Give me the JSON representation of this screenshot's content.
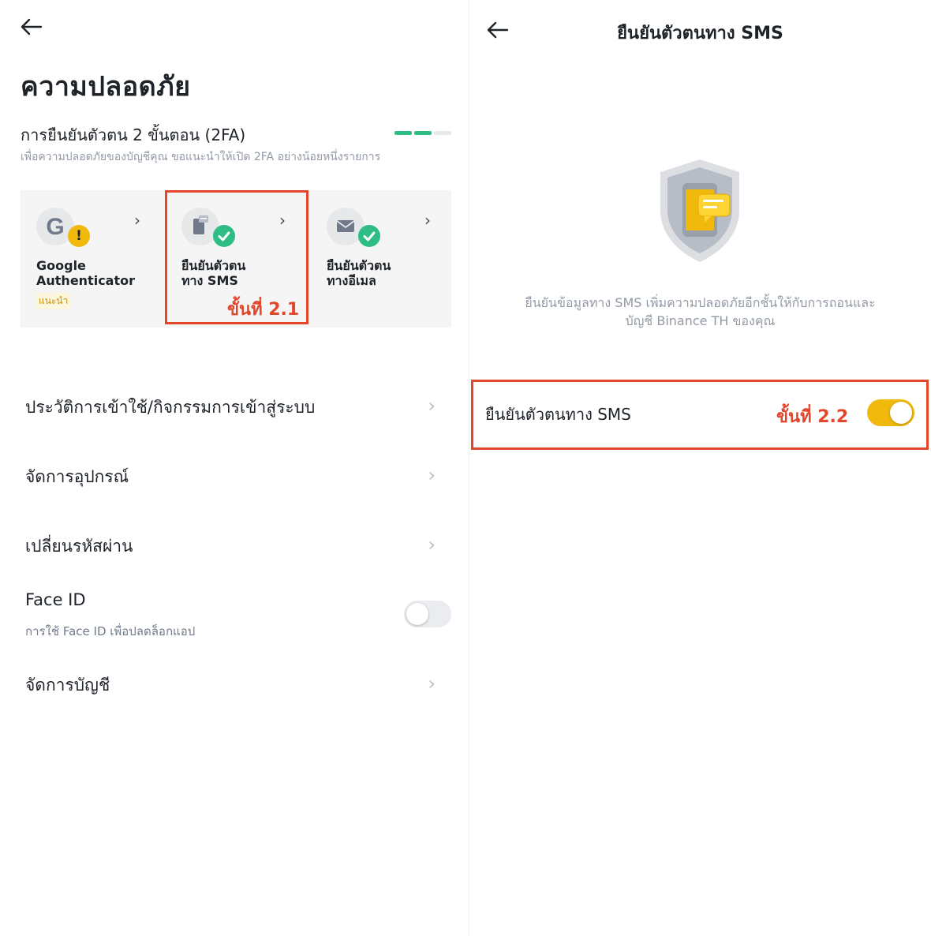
{
  "left": {
    "title": "ความปลอดภัย",
    "twofa": {
      "title": "การยืนยันตัวตน 2 ขั้นตอน (2FA)",
      "subtitle": "เพื่อความปลอดภัยของบัญชีคุณ ขอแนะนำให้เปิด 2FA อย่างน้อยหนึ่งรายการ",
      "progress_segments": [
        "#2ebd85",
        "#2ebd85",
        "#e6e8ea"
      ]
    },
    "methods": [
      {
        "label": "Google\nAuthenticator",
        "tag": "แนะนำ",
        "icon": "google-g-icon",
        "badge": "warning-icon"
      },
      {
        "label": "ยืนยันตัวตน\nทาง SMS",
        "icon": "phone-sms-icon",
        "badge": "check-icon"
      },
      {
        "label": "ยืนยันตัวตน\nทางอีเมล",
        "icon": "email-icon",
        "badge": "check-icon"
      }
    ],
    "step_label": "ขั้นที่ 2.1",
    "menu": [
      {
        "label": "ประวัติการเข้าใช้/กิจกรรมการเข้าสู่ระบบ"
      },
      {
        "label": "จัดการอุปกรณ์"
      },
      {
        "label": "เปลี่ยนรหัสผ่าน"
      },
      {
        "label": "Face ID",
        "sub": "การใช้ Face ID เพื่อปลดล็อกแอป",
        "toggle": false
      },
      {
        "label": "จัดการบัญชี"
      }
    ]
  },
  "right": {
    "title": "ยืนยันตัวตนทาง SMS",
    "description": "ยืนยันข้อมูลทาง SMS เพิ่มความปลอดภัยอีกชั้นให้กับการถอนและ\nบัญชี Binance TH ของคุณ",
    "row_label": "ยืนยันตัวตนทาง SMS",
    "step_label": "ขั้นที่ 2.2",
    "toggle": true
  },
  "colors": {
    "accent": "#f0b90b",
    "success": "#2ebd85",
    "warning": "#f0b90b",
    "annotation": "#e2472b"
  }
}
